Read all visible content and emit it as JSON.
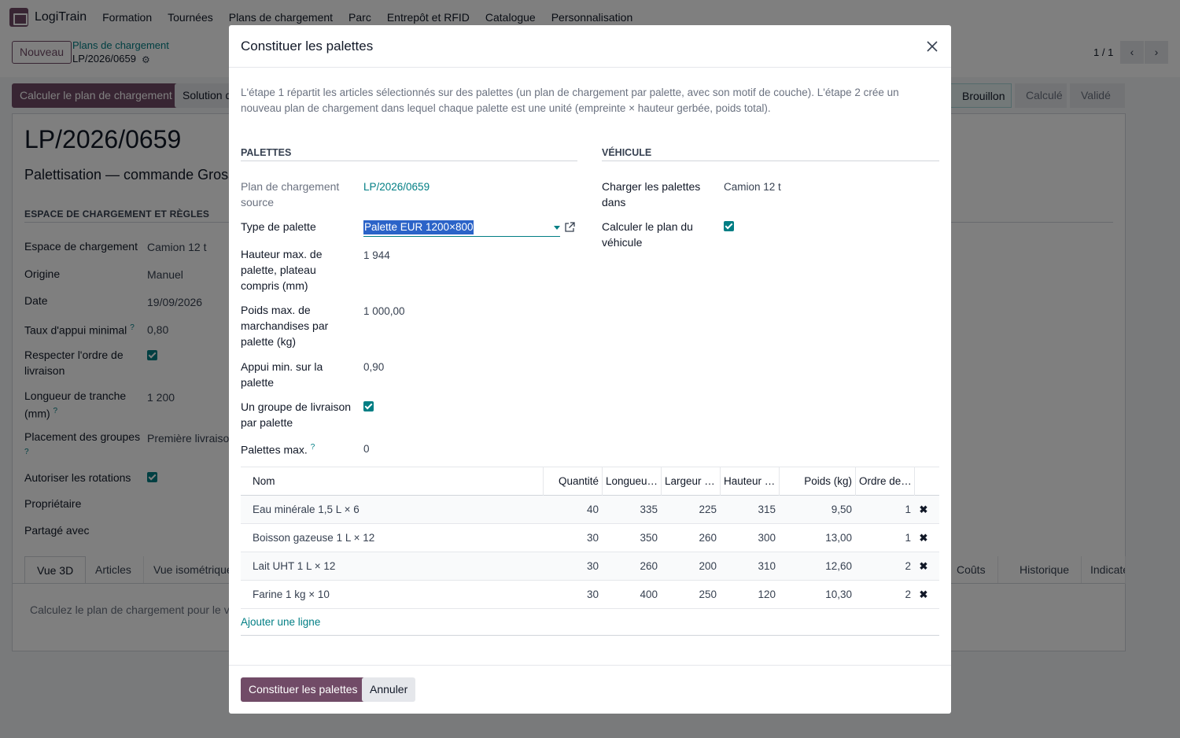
{
  "navbar": {
    "app_name": "LogiTrain",
    "menus": [
      "Formation",
      "Tournées",
      "Plans de chargement",
      "Parc",
      "Entrepôt et RFID",
      "Catalogue",
      "Personnalisation"
    ]
  },
  "control": {
    "new_label": "Nouveau",
    "breadcrumb_parent": "Plans de chargement",
    "breadcrumb_current": "LP/2026/0659",
    "pager": "1 / 1"
  },
  "statusbar": {
    "primary_button": "Calculer le plan de chargement",
    "secondary_button": "Solution de",
    "stages": [
      "Brouillon",
      "Calculé",
      "Validé"
    ],
    "active_stage": "Brouillon"
  },
  "record": {
    "title": "LP/2026/0659",
    "subtitle": "Palettisation — commande Grossis",
    "section": "ESPACE DE CHARGEMENT ET RÈGLES",
    "fields": [
      {
        "label": "Espace de chargement",
        "value": "Camion 12 t"
      },
      {
        "label": "Origine",
        "value": "Manuel"
      },
      {
        "label": "Date",
        "value": "19/09/2026"
      },
      {
        "label": "Taux d'appui minimal",
        "value": "0,80"
      },
      {
        "label": "Respecter l'ordre de livraison",
        "value": ""
      },
      {
        "label": "Longueur de tranche (mm)",
        "value": "1 200"
      },
      {
        "label": "Placement des groupes",
        "value": "Première livraison"
      },
      {
        "label": "Autoriser les rotations",
        "value": ""
      },
      {
        "label": "Propriétaire",
        "value": ""
      },
      {
        "label": "Partagé avec",
        "value": ""
      }
    ],
    "tabs": [
      "Vue 3D",
      "Articles",
      "Vue isométrique",
      "Coûts",
      "Historique",
      "Indicate"
    ],
    "hint": "Calculez le plan de chargement pour le voir"
  },
  "modal": {
    "title": "Constituer les palettes",
    "intro": "L'étape 1 répartit les articles sélectionnés sur des palettes (un plan de chargement par palette, avec son motif de couche). L'étape 2 crée un nouveau plan de chargement dans lequel chaque palette est une unité (empreinte × hauteur gerbée, poids total).",
    "palettes_title": "PALETTES",
    "vehicule_title": "VÉHICULE",
    "source_label": "Plan de chargement source",
    "source_value": "LP/2026/0659",
    "type_label": "Type de palette",
    "type_value": "Palette EUR 1200×800",
    "height_label": "Hauteur max. de palette, plateau compris (mm)",
    "height_value": "1 944",
    "weight_label": "Poids max. de marchandises par palette (kg)",
    "weight_value": "1 000,00",
    "support_label": "Appui min. sur la palette",
    "support_value": "0,90",
    "group_label": "Un groupe de livraison par palette",
    "max_label": "Palettes max.",
    "max_value": "0",
    "load_into_label": "Charger les palettes dans",
    "load_into_value": "Camion 12 t",
    "compute_label": "Calculer le plan du véhicule",
    "columns": [
      "Nom",
      "Quantité",
      "Longueu…",
      "Largeur …",
      "Hauteur …",
      "Poids (kg)",
      "Ordre de…"
    ],
    "rows": [
      {
        "name": "Eau minérale 1,5 L × 6",
        "qty": "40",
        "length": "335",
        "width": "225",
        "height": "315",
        "weight": "9,50",
        "order": "1"
      },
      {
        "name": "Boisson gazeuse 1 L × 12",
        "qty": "30",
        "length": "350",
        "width": "260",
        "height": "300",
        "weight": "13,00",
        "order": "1"
      },
      {
        "name": "Lait UHT 1 L × 12",
        "qty": "30",
        "length": "260",
        "width": "200",
        "height": "310",
        "weight": "12,60",
        "order": "2"
      },
      {
        "name": "Farine 1 kg × 10",
        "qty": "30",
        "length": "400",
        "width": "250",
        "height": "120",
        "weight": "10,30",
        "order": "2"
      }
    ],
    "add_line": "Ajouter une ligne",
    "confirm_label": "Constituer les palettes",
    "cancel_label": "Annuler"
  },
  "colors": {
    "primary": "#714b67",
    "accent": "#017e84"
  }
}
